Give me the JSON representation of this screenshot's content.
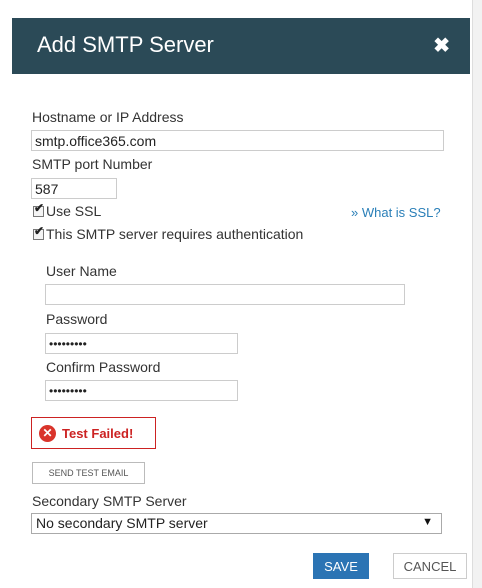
{
  "dialog": {
    "title": "Add SMTP Server",
    "close_label": "✖"
  },
  "form": {
    "hostname": {
      "label": "Hostname or IP Address",
      "value": "smtp.office365.com"
    },
    "port": {
      "label": "SMTP port Number",
      "value": "587"
    },
    "use_ssl": {
      "label": "Use SSL",
      "checked": true
    },
    "ssl_help_link": "» What is SSL?",
    "requires_auth": {
      "label": "This SMTP server requires authentication",
      "checked": true
    },
    "username": {
      "label": "User Name",
      "value": ""
    },
    "password": {
      "label": "Password",
      "masked_value": "•••••••••"
    },
    "confirm_password": {
      "label": "Confirm Password",
      "masked_value": "•••••••••"
    }
  },
  "test_status": {
    "icon": "error-circle-icon",
    "text": "Test Failed!"
  },
  "send_test_button": "SEND TEST EMAIL",
  "secondary_server": {
    "label": "Secondary SMTP Server",
    "selected": "No secondary SMTP server"
  },
  "buttons": {
    "save": "SAVE",
    "cancel": "CANCEL"
  }
}
